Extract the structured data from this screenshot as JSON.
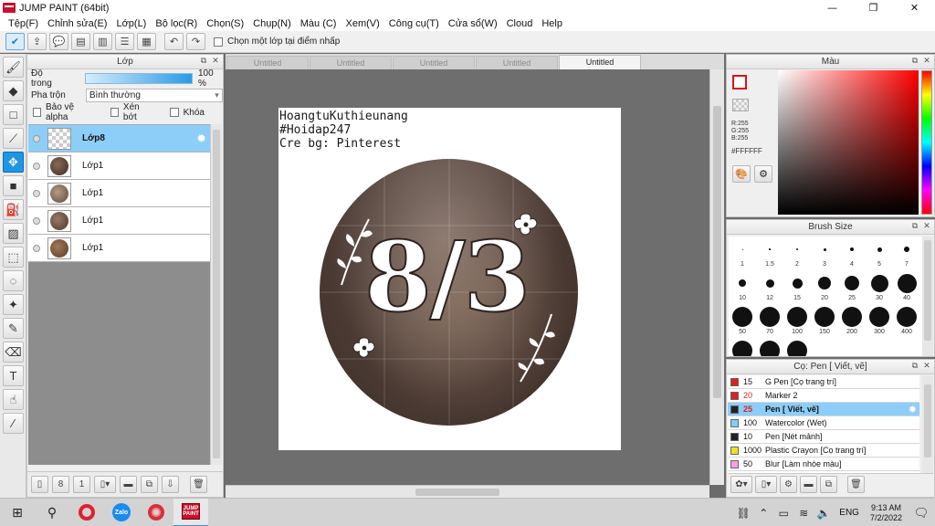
{
  "window": {
    "title": "JUMP PAINT (64bit)",
    "minimize": "—",
    "maximize": "❐",
    "close": "✕"
  },
  "menu": [
    "Tệp(F)",
    "Chỉnh sửa(E)",
    "Lớp(L)",
    "Bộ lọc(R)",
    "Chọn(S)",
    "Chụp(N)",
    "Màu (C)",
    "Xem(V)",
    "Công cụ(T)",
    "Cửa sổ(W)",
    "Cloud",
    "Help"
  ],
  "toolbar": {
    "select_layer_label": "Chọn một lớp tại điểm nhấp"
  },
  "layer_panel": {
    "title": "Lớp",
    "opacity_label": "Độ trong",
    "opacity_value": "100 %",
    "opacity_fraction": 1.0,
    "blend_label": "Pha trộn",
    "blend_value": "Bình thường",
    "protect_alpha": "Bảo vệ alpha",
    "clip": "Xén bớt",
    "lock": "Khóa",
    "layers": [
      {
        "name": "Lớp8",
        "selected": true,
        "transparent": true
      },
      {
        "name": "Lớp1",
        "selected": false,
        "transparent": false
      },
      {
        "name": "Lớp1",
        "selected": false,
        "transparent": false
      },
      {
        "name": "Lớp1",
        "selected": false,
        "transparent": false
      },
      {
        "name": "Lớp1",
        "selected": false,
        "transparent": false
      }
    ]
  },
  "doc_tabs": [
    {
      "label": "Untitled",
      "active": false
    },
    {
      "label": "Untitled",
      "active": false
    },
    {
      "label": "Untitled",
      "active": false
    },
    {
      "label": "Untitled",
      "active": false
    },
    {
      "label": "Untitled",
      "active": true
    }
  ],
  "canvas": {
    "text_line1": "HoangtuKuthieunang",
    "text_line2": "#Hoidap247",
    "text_line3": "Cre bg: Pinterest",
    "big_text": "8/3"
  },
  "color_panel": {
    "title": "Màu",
    "r": "R:255",
    "g": "G:255",
    "b": "B:255",
    "hex": "#FFFFFF",
    "front_color": "#ffffff",
    "accent": "#e01010"
  },
  "brush_panel": {
    "title": "Brush Size",
    "sizes": [
      "1",
      "1.5",
      "2",
      "3",
      "4",
      "5",
      "7",
      "10",
      "12",
      "15",
      "20",
      "25",
      "30",
      "40",
      "50",
      "70",
      "100",
      "150",
      "200",
      "300",
      "400",
      "",
      "",
      ""
    ]
  },
  "subtool_panel": {
    "title": "Cọ: Pen [ Viết, vẽ]",
    "items": [
      {
        "size": "15",
        "name": "G Pen [Cọ trang trí]",
        "color": "#e02020",
        "selected": false
      },
      {
        "size": "20",
        "name": "Marker 2",
        "color": "#e02020",
        "selected": false
      },
      {
        "size": "25",
        "name": "Pen [ Viết, vẽ]",
        "color": "#222222",
        "selected": true
      },
      {
        "size": "100",
        "name": "Watercolor (Wet)",
        "color": "#7ad0f5",
        "selected": false
      },
      {
        "size": "10",
        "name": "Pen [Nét mảnh]",
        "color": "#222222",
        "selected": false
      },
      {
        "size": "1000",
        "name": "Plastic Crayon [Cọ trang trí]",
        "color": "#f0e020",
        "selected": false
      },
      {
        "size": "50",
        "name": "Blur [Làm nhòe màu]",
        "color": "#f5a0e0",
        "selected": false
      }
    ]
  },
  "taskbar": {
    "lang": "ENG",
    "time": "9:13 AM",
    "date": "7/2/2022",
    "zalo_label": "Zalo",
    "jump_label": "JUMP PAINT"
  }
}
